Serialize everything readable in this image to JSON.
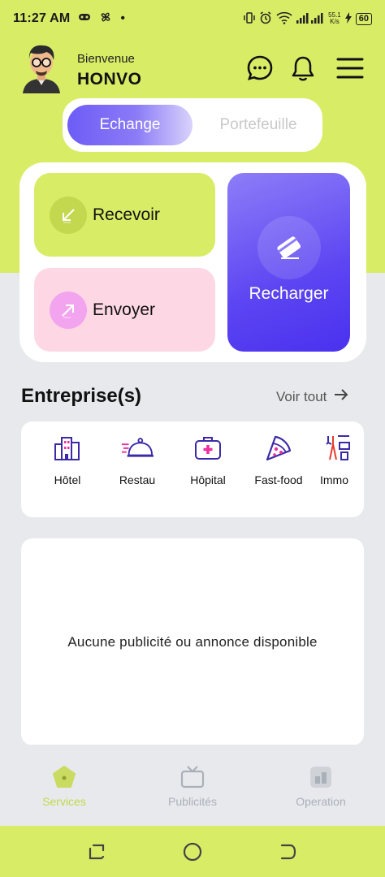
{
  "status_bar": {
    "time": "11:27 AM",
    "dot": "•",
    "speed_value": "55.1",
    "speed_unit": "K/s",
    "battery": "60"
  },
  "header": {
    "greeting": "Bienvenue",
    "username": "HONVO",
    "icons": [
      "chat-icon",
      "bell-icon",
      "menu-icon"
    ]
  },
  "tabs": {
    "active": "Echange",
    "inactive": "Portefeuille"
  },
  "actions": {
    "receive": "Recevoir",
    "send": "Envoyer",
    "recharge": "Recharger"
  },
  "enterprises": {
    "title": "Entreprise(s)",
    "see_all": "Voir tout",
    "categories": [
      {
        "label": "Hôtel",
        "icon": "hotel-icon"
      },
      {
        "label": "Restau",
        "icon": "restaurant-icon"
      },
      {
        "label": "Hôpital",
        "icon": "hospital-icon"
      },
      {
        "label": "Fast-food",
        "icon": "pizza-icon"
      },
      {
        "label": "Immo",
        "icon": "real-estate-icon"
      }
    ]
  },
  "ads": {
    "empty_message": "Aucune publicité ou annonce disponible"
  },
  "bottom_nav": {
    "items": [
      {
        "label": "Services",
        "icon": "services-icon",
        "active": true
      },
      {
        "label": "Publicités",
        "icon": "tv-icon",
        "active": false
      },
      {
        "label": "Operation",
        "icon": "operation-icon",
        "active": false
      }
    ]
  },
  "colors": {
    "accent_lime": "#d9ec66",
    "accent_purple": "#5c45f2",
    "send_pink": "#fdd8e4",
    "nav_active": "#c2d84a"
  }
}
